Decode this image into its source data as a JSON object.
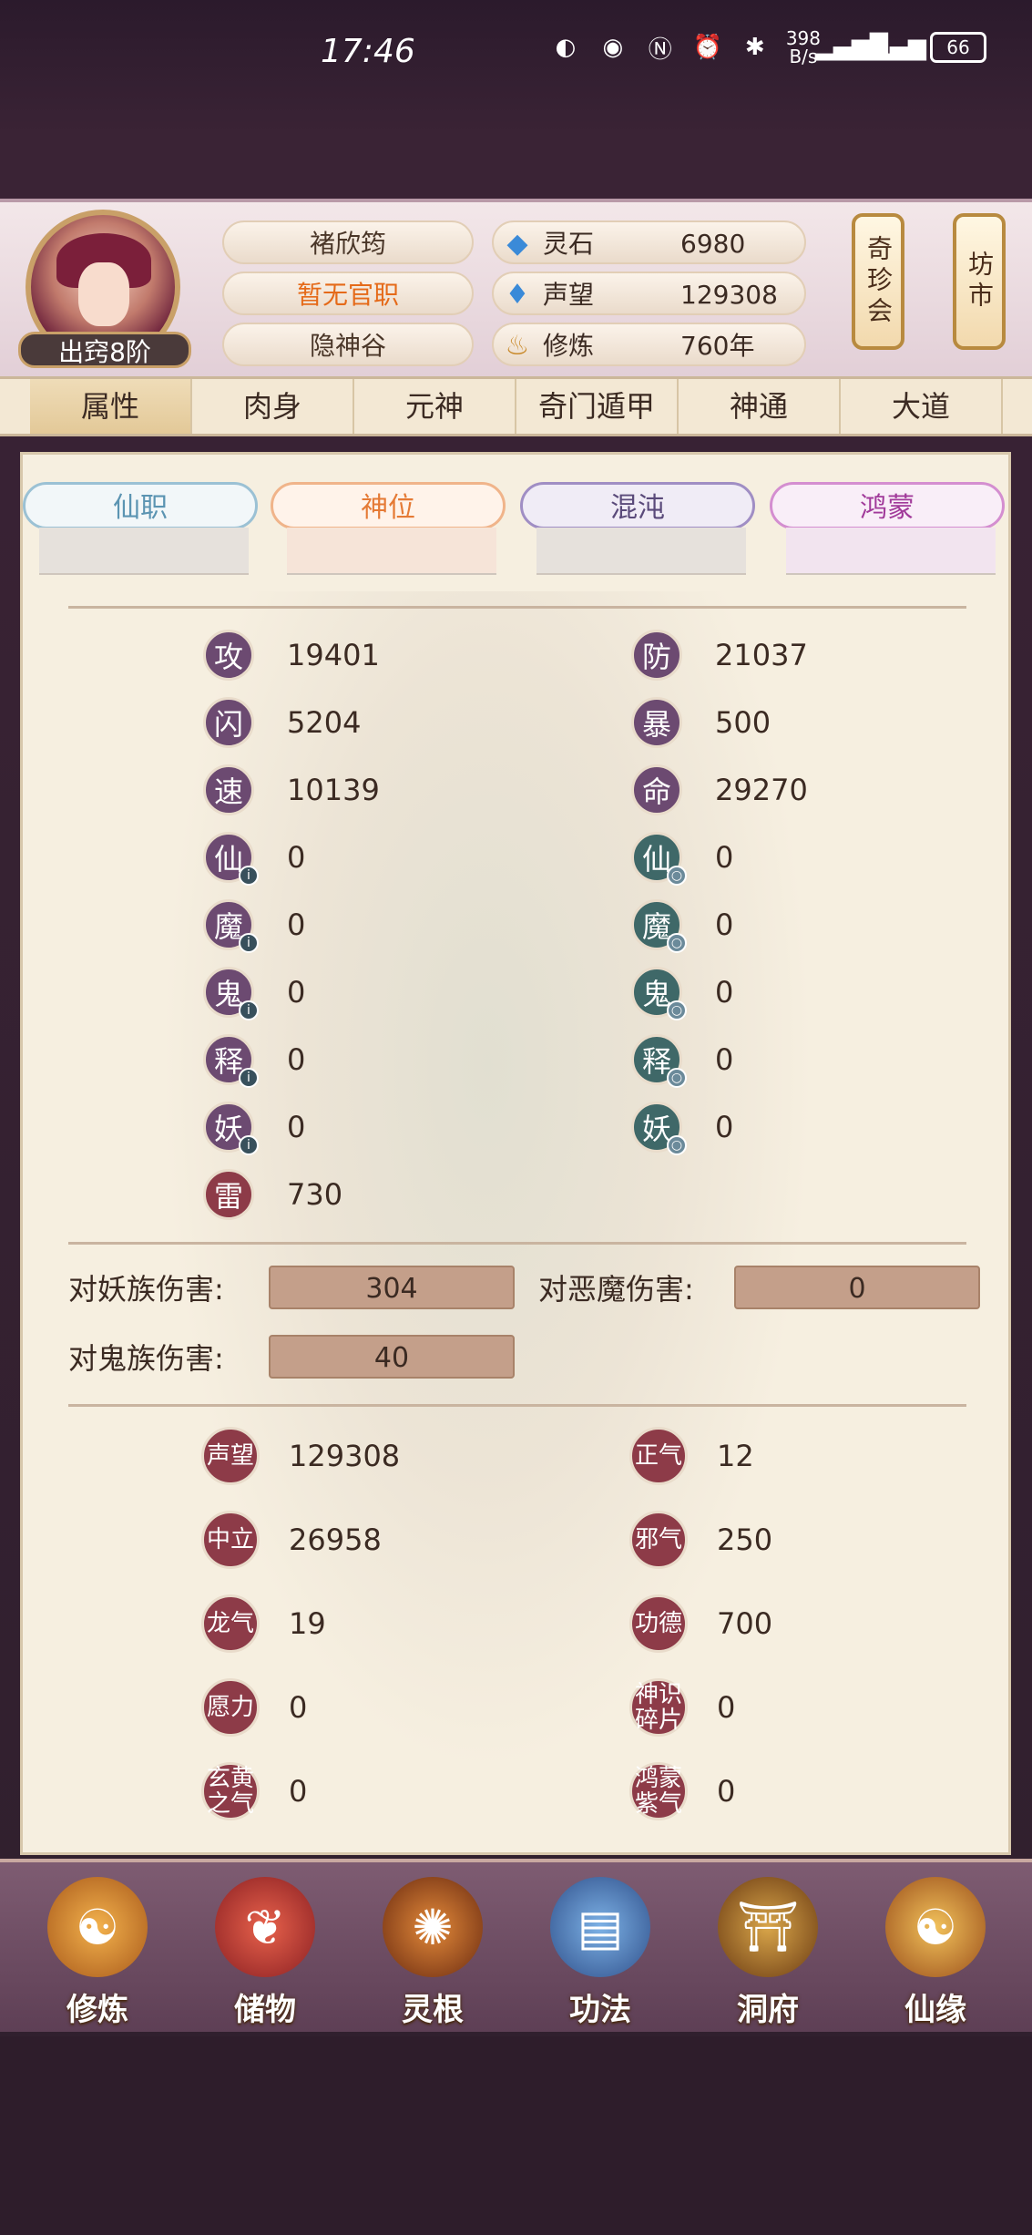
{
  "status_bar": {
    "time": "17:46",
    "speed_value": "398",
    "speed_unit": "B/s",
    "battery": "66"
  },
  "profile": {
    "name": "褚欣筠",
    "office": "暂无官职",
    "clan": "隐神谷",
    "rank": "出窍8阶"
  },
  "resources": [
    {
      "label": "灵石",
      "value": "6980",
      "icon": "spirit-stone-icon",
      "color": "#3a8ad8"
    },
    {
      "label": "声望",
      "value": "129308",
      "icon": "prestige-icon",
      "color": "#3a8ad8"
    },
    {
      "label": "修炼",
      "value": "760年",
      "icon": "cultivation-icon",
      "color": "#c98a2b"
    }
  ],
  "side_buttons": {
    "treasure": "奇珍会",
    "market": "坊市"
  },
  "tabs": [
    "属性",
    "肉身",
    "元神",
    "奇门遁甲",
    "神通",
    "大道"
  ],
  "rank_tabs": [
    {
      "label": "仙职",
      "color": "#5b94b2"
    },
    {
      "label": "神位",
      "color": "#e57a35"
    },
    {
      "label": "混沌",
      "color": "#5a4a7a"
    },
    {
      "label": "鸿蒙",
      "color": "#a13a9a"
    }
  ],
  "stats_left": [
    {
      "label": "攻",
      "value": "19401"
    },
    {
      "label": "闪",
      "value": "5204"
    },
    {
      "label": "速",
      "value": "10139"
    },
    {
      "label": "仙",
      "value": "0"
    },
    {
      "label": "魔",
      "value": "0"
    },
    {
      "label": "鬼",
      "value": "0"
    },
    {
      "label": "释",
      "value": "0"
    },
    {
      "label": "妖",
      "value": "0"
    },
    {
      "label": "雷",
      "value": "730"
    }
  ],
  "stats_right": [
    {
      "label": "防",
      "value": "21037"
    },
    {
      "label": "暴",
      "value": "500"
    },
    {
      "label": "命",
      "value": "29270"
    },
    {
      "label": "仙",
      "value": "0"
    },
    {
      "label": "魔",
      "value": "0"
    },
    {
      "label": "鬼",
      "value": "0"
    },
    {
      "label": "释",
      "value": "0"
    },
    {
      "label": "妖",
      "value": "0"
    }
  ],
  "damage": {
    "yao_label": "对妖族伤害:",
    "yao_value": "304",
    "demon_label": "对恶魔伤害:",
    "demon_value": "0",
    "ghost_label": "对鬼族伤害:",
    "ghost_value": "40"
  },
  "attributes_left": [
    {
      "label": "声望",
      "value": "129308"
    },
    {
      "label": "中立",
      "value": "26958"
    },
    {
      "label": "龙气",
      "value": "19"
    },
    {
      "label": "愿力",
      "value": "0"
    },
    {
      "label": "玄黄之气",
      "value": "0"
    }
  ],
  "attributes_right": [
    {
      "label": "正气",
      "value": "12"
    },
    {
      "label": "邪气",
      "value": "250"
    },
    {
      "label": "功德",
      "value": "700"
    },
    {
      "label": "神识碎片",
      "value": "0"
    },
    {
      "label": "鸿蒙紫气",
      "value": "0"
    }
  ],
  "bottom_nav": [
    "修炼",
    "储物",
    "灵根",
    "功法",
    "洞府",
    "仙缘"
  ]
}
